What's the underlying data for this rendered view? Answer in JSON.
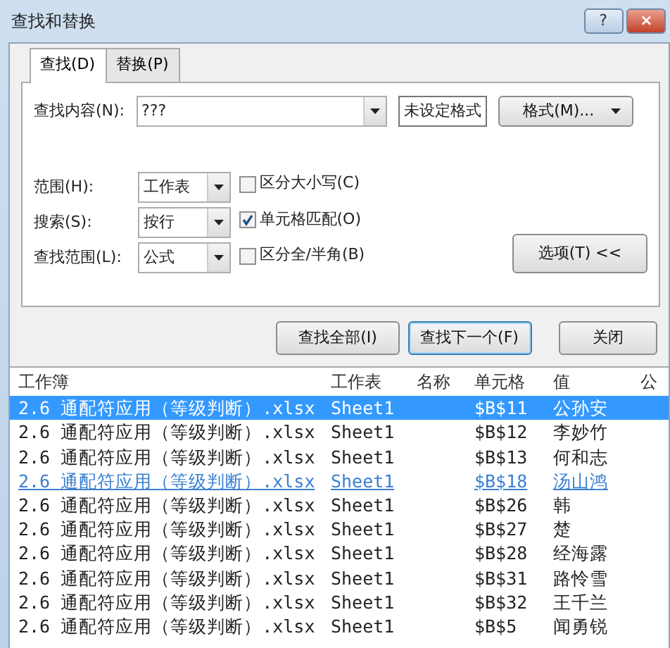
{
  "window": {
    "title": "查找和替换",
    "help": "?",
    "close": "×"
  },
  "tabs": [
    {
      "label": "查找(D)",
      "selected": true
    },
    {
      "label": "替换(P)",
      "selected": false
    }
  ],
  "find": {
    "label": "查找内容(N):",
    "value": "???",
    "format_preview": "未设定格式",
    "format_button": "格式(M)..."
  },
  "options": [
    {
      "label": "范围(H):",
      "value": "工作表"
    },
    {
      "label": "搜索(S):",
      "value": "按行"
    },
    {
      "label": "查找范围(L):",
      "value": "公式"
    }
  ],
  "checkboxes": [
    {
      "label": "区分大小写(C)",
      "checked": false
    },
    {
      "label": "单元格匹配(O)",
      "checked": true
    },
    {
      "label": "区分全/半角(B)",
      "checked": false
    }
  ],
  "options_button": "选项(T) <<",
  "buttons": [
    {
      "label": "查找全部(I)",
      "default": false
    },
    {
      "label": "查找下一个(F)",
      "default": true
    },
    {
      "label": "关闭",
      "default": false
    }
  ],
  "results": {
    "columns": [
      "工作簿",
      "工作表",
      "名称",
      "单元格",
      "值",
      "公"
    ],
    "rows": [
      {
        "workbook": "2.6 通配符应用（等级判断）.xlsx",
        "sheet": "Sheet1",
        "cell": "$B$11",
        "value": "公孙安",
        "selected": true,
        "hovered": false
      },
      {
        "workbook": "2.6 通配符应用（等级判断）.xlsx",
        "sheet": "Sheet1",
        "cell": "$B$12",
        "value": "李妙竹",
        "selected": false,
        "hovered": false
      },
      {
        "workbook": "2.6 通配符应用（等级判断）.xlsx",
        "sheet": "Sheet1",
        "cell": "$B$13",
        "value": "何和志",
        "selected": false,
        "hovered": false
      },
      {
        "workbook": "2.6 通配符应用（等级判断）.xlsx",
        "sheet": "Sheet1",
        "cell": "$B$18",
        "value": "汤山鸿",
        "selected": false,
        "hovered": true
      },
      {
        "workbook": "2.6 通配符应用（等级判断）.xlsx",
        "sheet": "Sheet1",
        "cell": "$B$26",
        "value": "韩",
        "selected": false,
        "hovered": false
      },
      {
        "workbook": "2.6 通配符应用（等级判断）.xlsx",
        "sheet": "Sheet1",
        "cell": "$B$27",
        "value": "楚",
        "selected": false,
        "hovered": false
      },
      {
        "workbook": "2.6 通配符应用（等级判断）.xlsx",
        "sheet": "Sheet1",
        "cell": "$B$28",
        "value": "经海露",
        "selected": false,
        "hovered": false
      },
      {
        "workbook": "2.6 通配符应用（等级判断）.xlsx",
        "sheet": "Sheet1",
        "cell": "$B$31",
        "value": "路怜雪",
        "selected": false,
        "hovered": false
      },
      {
        "workbook": "2.6 通配符应用（等级判断）.xlsx",
        "sheet": "Sheet1",
        "cell": "$B$32",
        "value": "王千兰",
        "selected": false,
        "hovered": false
      },
      {
        "workbook": "2.6 通配符应用（等级判断）.xlsx",
        "sheet": "Sheet1",
        "cell": "$B$5",
        "value": "闻勇锐",
        "selected": false,
        "hovered": false
      }
    ]
  }
}
